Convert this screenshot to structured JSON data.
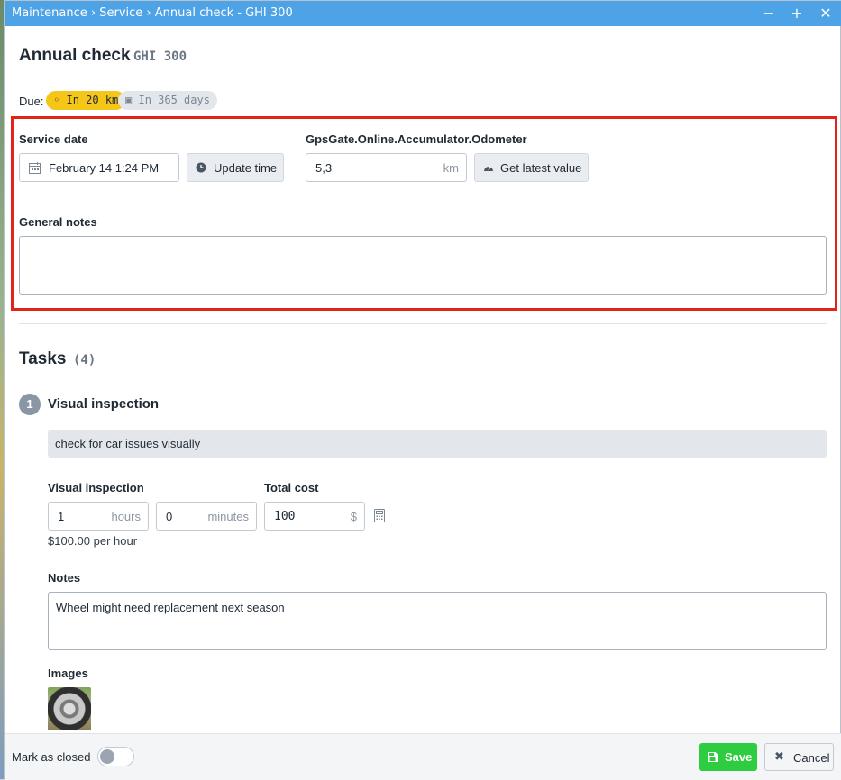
{
  "titlebar": {
    "crumbs": [
      "Maintenance",
      "Service",
      "Annual check - GHI 300"
    ],
    "separator": "›",
    "minimize_icon": "minus-icon",
    "maximize_icon": "plus-icon",
    "close_icon": "close-icon"
  },
  "header": {
    "title": "Annual check",
    "subtitle": "GHI 300"
  },
  "due": {
    "label": "Due:",
    "km_badge": "In 20 km",
    "days_badge": "In 365 days",
    "km_badge_color": "#f5c518",
    "days_badge_color": "#e3e7ec"
  },
  "service": {
    "date_label": "Service date",
    "date_value": "February 14 1:24 PM",
    "update_time_label": "Update time",
    "odometer_label": "GpsGate.Online.Accumulator.Odometer",
    "odometer_value": "5,3",
    "odometer_unit": "km",
    "latest_value_label": "Get latest value",
    "general_notes_label": "General notes",
    "general_notes_value": ""
  },
  "tasks": {
    "title": "Tasks",
    "count": "(4)",
    "items": [
      {
        "number": "1",
        "name": "Visual inspection",
        "description": "check for car issues visually",
        "time_label": "Visual inspection",
        "hours_value": "1",
        "hours_unit": "hours",
        "minutes_value": "0",
        "minutes_unit": "minutes",
        "cost_label": "Total cost",
        "cost_value": "100",
        "cost_unit": "$",
        "rate_text": "$100.00 per hour",
        "notes_label": "Notes",
        "notes_value": "Wheel might need replacement next season",
        "images_label": "Images"
      }
    ]
  },
  "footer": {
    "mark_closed_label": "Mark as closed",
    "mark_closed_value": false,
    "save_label": "Save",
    "cancel_label": "Cancel"
  },
  "colors": {
    "titlebar": "#4da3e6",
    "highlight": "#e0241b",
    "save": "#2ecc40"
  }
}
